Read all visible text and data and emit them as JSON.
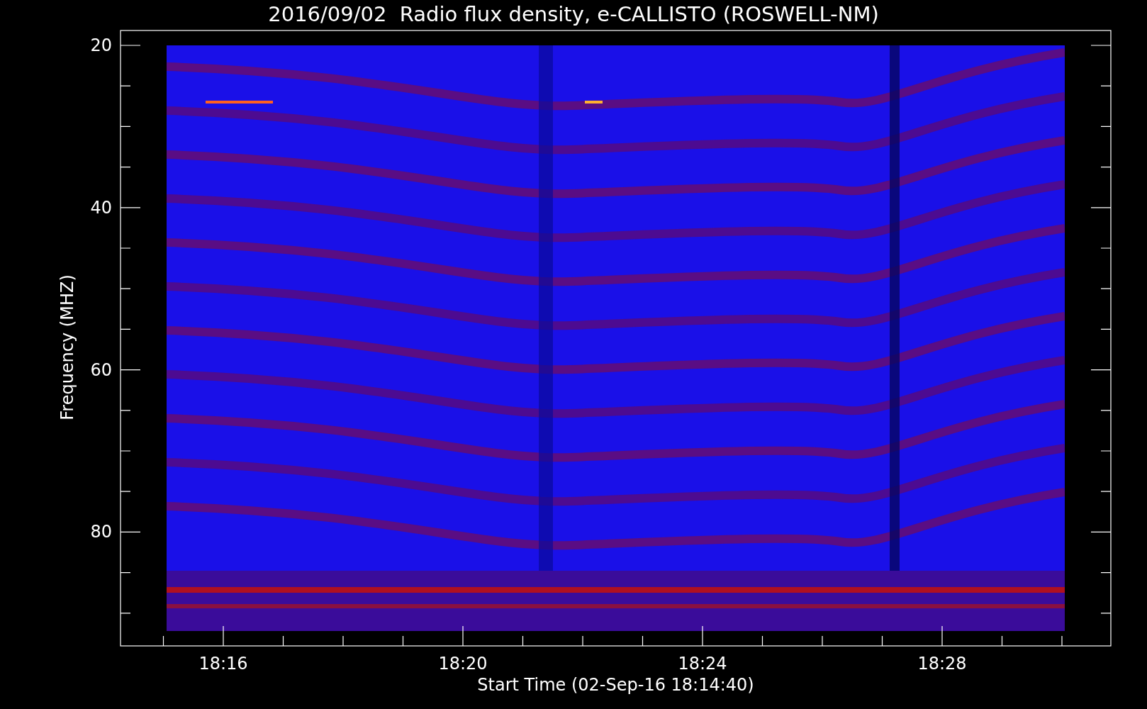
{
  "title": "2016/09/02  Radio flux density, e-CALLISTO (ROSWELL-NM)",
  "y_axis": {
    "label": "Frequency (MHZ)",
    "ticks": [
      "20",
      "40",
      "60",
      "80"
    ]
  },
  "x_axis": {
    "label": "Start Time (02-Sep-16 18:14:40)",
    "ticks": [
      "18:16",
      "18:20",
      "18:24",
      "18:28"
    ]
  }
}
